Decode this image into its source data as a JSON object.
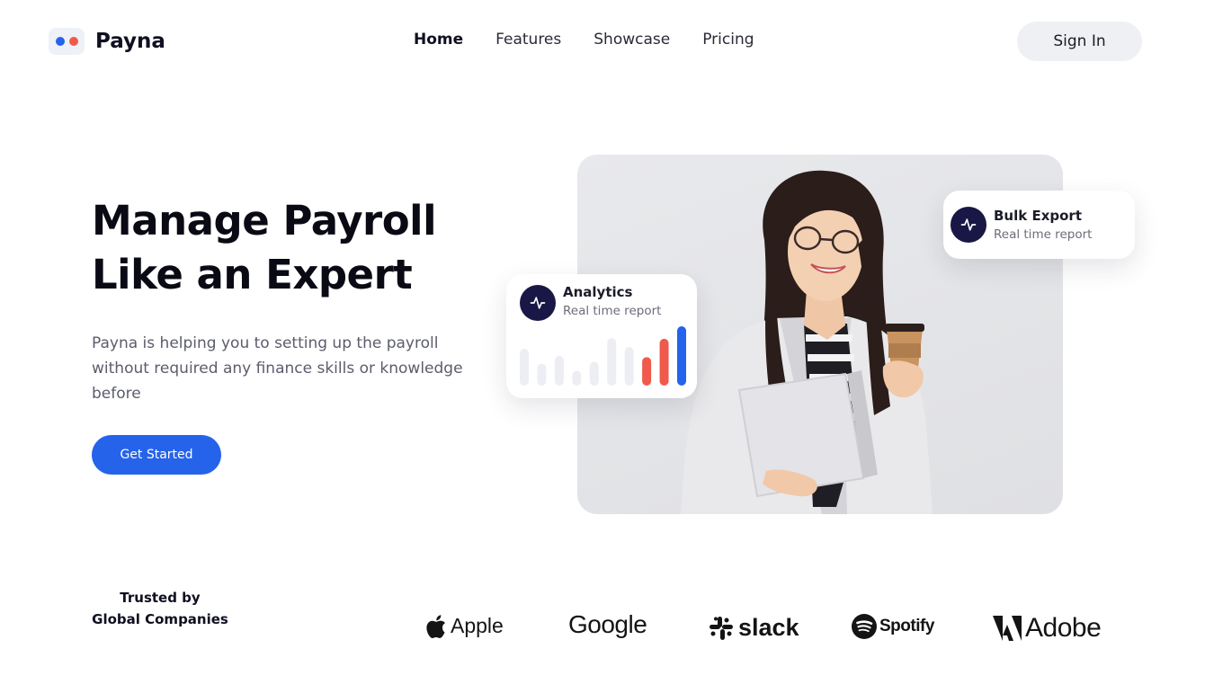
{
  "brand": {
    "name": "Payna",
    "dot_colors": [
      "#2563eb",
      "#ef5a4c"
    ]
  },
  "nav": {
    "items": [
      {
        "label": "Home",
        "active": true
      },
      {
        "label": "Features",
        "active": false
      },
      {
        "label": "Showcase",
        "active": false
      },
      {
        "label": "Pricing",
        "active": false
      }
    ]
  },
  "header": {
    "signin_label": "Sign In"
  },
  "hero": {
    "title_line1": "Manage Payroll",
    "title_line2": "Like an Expert",
    "description": "Payna is helping you to setting up the payroll without required any finance skills or knowledge before",
    "cta_label": "Get Started",
    "image": "person-holding-laptop-and-coffee"
  },
  "cards": {
    "analytics": {
      "title": "Analytics",
      "subtitle": "Real time report",
      "icon": "activity-pulse-icon",
      "bars": [
        {
          "value": 0.62,
          "color": "#eceef3"
        },
        {
          "value": 0.37,
          "color": "#eceef3"
        },
        {
          "value": 0.5,
          "color": "#eceef3"
        },
        {
          "value": 0.25,
          "color": "#eceef3"
        },
        {
          "value": 0.4,
          "color": "#eceef3"
        },
        {
          "value": 0.8,
          "color": "#eceef3"
        },
        {
          "value": 0.65,
          "color": "#eceef3"
        },
        {
          "value": 0.48,
          "color": "#ef5a4c"
        },
        {
          "value": 0.79,
          "color": "#ef5a4c"
        },
        {
          "value": 1.0,
          "color": "#2563eb"
        }
      ]
    },
    "export": {
      "title": "Bulk Export",
      "subtitle": "Real time report",
      "icon": "activity-pulse-icon"
    }
  },
  "trusted": {
    "line1": "Trusted by",
    "line2": "Global Companies"
  },
  "logos": [
    {
      "name": "Apple",
      "icon": "apple-icon"
    },
    {
      "name": "Google",
      "icon": ""
    },
    {
      "name": "slack",
      "icon": "slack-icon"
    },
    {
      "name": "Spotify",
      "icon": "spotify-icon"
    },
    {
      "name": "Adobe",
      "icon": "adobe-icon"
    }
  ],
  "colors": {
    "accent": "#2563eb",
    "highlight": "#ef5a4c",
    "icon_bg": "#191745"
  }
}
